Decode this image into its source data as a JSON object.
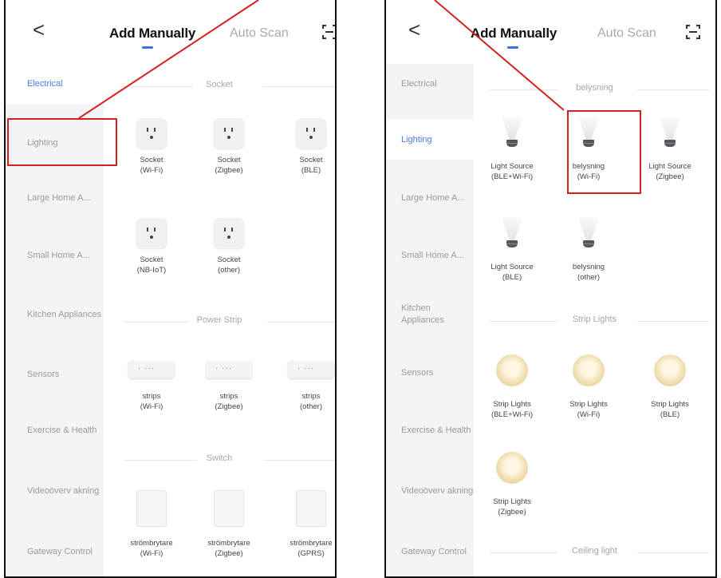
{
  "colors": {
    "accent": "#3f6fe0",
    "annotation": "#d42020",
    "sidebar_bg": "#f4f4f6"
  },
  "icons": {
    "back": "chevron-left-icon",
    "scan": "scan-frame-icon"
  },
  "left": {
    "header": {
      "back": "<",
      "tab_manual": "Add Manually",
      "tab_auto": "Auto Scan"
    },
    "sidebar": [
      "Electrical",
      "Lighting",
      "Large Home A...",
      "Small Home A...",
      "Kitchen Appliances",
      "Sensors",
      "Exercise & Health",
      "Videoöverv akning",
      "Gateway Control"
    ],
    "sections": [
      "Socket",
      "Power Strip",
      "Switch"
    ],
    "devices": [
      [
        "Socket",
        "(Wi-Fi)"
      ],
      [
        "Socket",
        "(Zigbee)"
      ],
      [
        "Socket",
        "(BLE)"
      ],
      [
        "Socket",
        "(NB-IoT)"
      ],
      [
        "Socket",
        "(other)"
      ],
      [
        "strips",
        "(Wi-Fi)"
      ],
      [
        "strips",
        "(Zigbee)"
      ],
      [
        "strips",
        "(other)"
      ],
      [
        "strömbrytare",
        "(Wi-Fi)"
      ],
      [
        "strömbrytare",
        "(Zigbee)"
      ],
      [
        "strömbrytare",
        "(GPRS)"
      ]
    ]
  },
  "right": {
    "header": {
      "back": "<",
      "tab_manual": "Add Manually",
      "tab_auto": "Auto Scan"
    },
    "sidebar": [
      "Electrical",
      "Lighting",
      "Large Home A...",
      "Small Home A...",
      "Kitchen Appliances",
      "Sensors",
      "Exercise & Health",
      "Videoöverv akning",
      "Gateway Control"
    ],
    "sections": [
      "belysning",
      "Strip Lights",
      "Ceiling light"
    ],
    "devices": [
      [
        "Light Source",
        "(BLE+Wi-Fi)"
      ],
      [
        "belysning",
        "(Wi-Fi)"
      ],
      [
        "Light Source",
        "(Zigbee)"
      ],
      [
        "Light Source",
        "(BLE)"
      ],
      [
        "belysning",
        "(other)"
      ],
      [
        "Strip Lights",
        "(BLE+Wi-Fi)"
      ],
      [
        "Strip Lights",
        "(Wi-Fi)"
      ],
      [
        "Strip Lights",
        "(BLE)"
      ],
      [
        "Strip Lights",
        "(Zigbee)"
      ]
    ]
  }
}
